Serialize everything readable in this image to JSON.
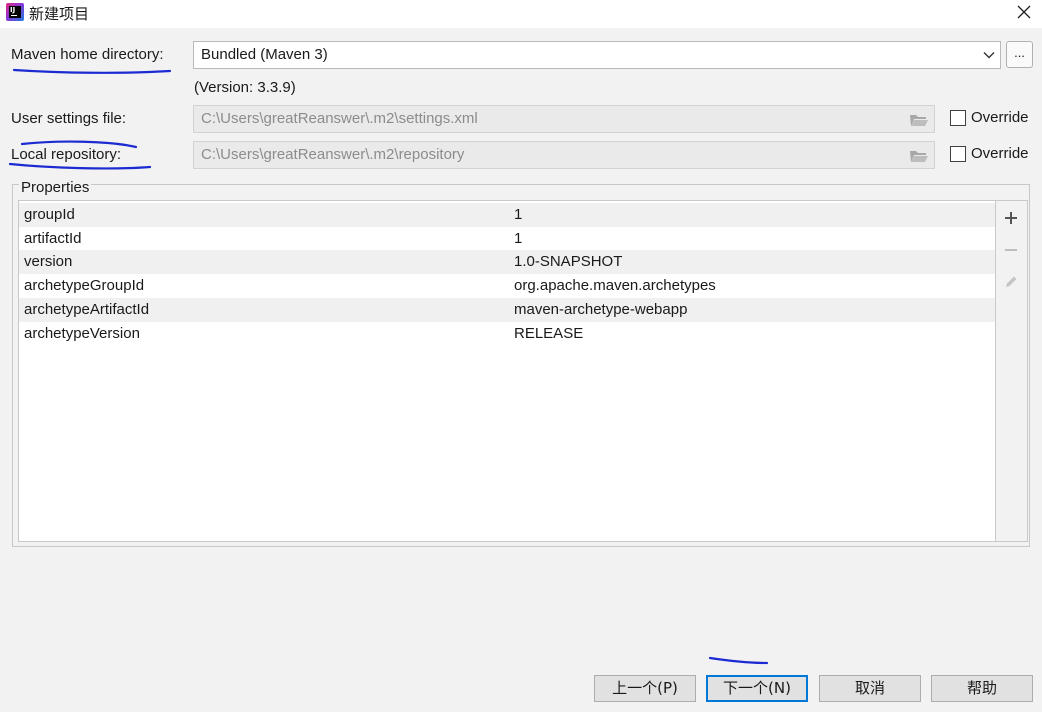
{
  "window": {
    "title": "新建项目",
    "close_icon": "close-icon"
  },
  "maven_home": {
    "label": "Maven home directory:",
    "value": "Bundled (Maven 3)",
    "browse_label": "...",
    "version_text": "(Version: 3.3.9)"
  },
  "user_settings": {
    "label": "User settings file:",
    "value": "C:\\Users\\greatReanswer\\.m2\\settings.xml",
    "override_label": "Override",
    "override_checked": false
  },
  "local_repo": {
    "label": "Local repository:",
    "value": "C:\\Users\\greatReanswer\\.m2\\repository",
    "override_label": "Override",
    "override_checked": false
  },
  "properties": {
    "title": "Properties",
    "rows": [
      {
        "key": "groupId",
        "value": "1"
      },
      {
        "key": "artifactId",
        "value": "1"
      },
      {
        "key": "version",
        "value": "1.0-SNAPSHOT"
      },
      {
        "key": "archetypeGroupId",
        "value": "org.apache.maven.archetypes"
      },
      {
        "key": "archetypeArtifactId",
        "value": "maven-archetype-webapp"
      },
      {
        "key": "archetypeVersion",
        "value": "RELEASE"
      }
    ],
    "toolbar_icons": [
      "add-icon",
      "remove-icon",
      "edit-icon"
    ]
  },
  "buttons": {
    "previous": "上一个(P)",
    "next": "下一个(N)",
    "cancel": "取消",
    "help": "帮助"
  },
  "colors": {
    "primary_border": "#0078d7",
    "annotation_ink": "#1c2bd1"
  }
}
